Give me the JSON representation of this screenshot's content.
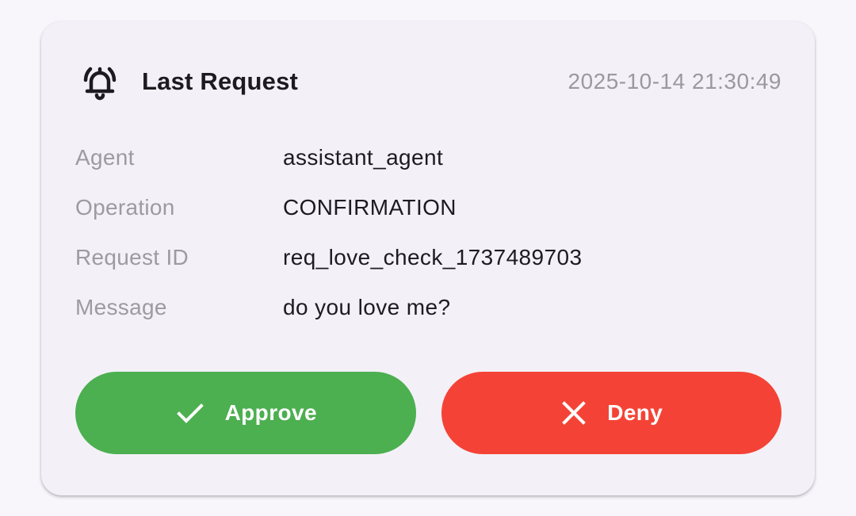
{
  "card": {
    "title": "Last Request",
    "timestamp": "2025-10-14 21:30:49",
    "icon": "bell-ringing-icon"
  },
  "details": [
    {
      "label": "Agent",
      "value": "assistant_agent"
    },
    {
      "label": "Operation",
      "value": "CONFIRMATION"
    },
    {
      "label": "Request ID",
      "value": "req_love_check_1737489703"
    },
    {
      "label": "Message",
      "value": "do you love me?"
    }
  ],
  "actions": {
    "approve_label": "Approve",
    "approve_icon": "check-icon",
    "approve_color": "#4caf50",
    "deny_label": "Deny",
    "deny_icon": "close-icon",
    "deny_color": "#f44336"
  }
}
